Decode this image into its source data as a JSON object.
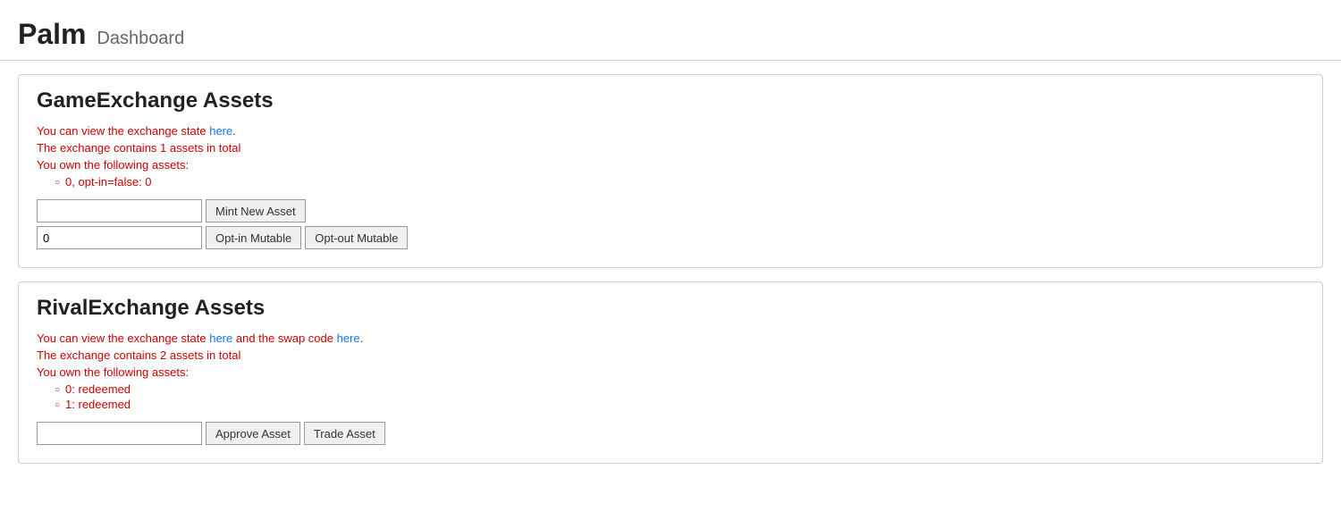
{
  "header": {
    "title": "Palm",
    "subtitle": "Dashboard"
  },
  "game_exchange": {
    "title": "GameExchange Assets",
    "info_line1_prefix": "You can view the exchange state ",
    "info_line1_link": "here",
    "info_line1_suffix": ".",
    "info_line2": "The exchange contains 1 assets in total",
    "info_line3": "You own the following assets:",
    "assets": [
      "0, opt-in=false: 0"
    ],
    "mint_input_placeholder": "",
    "mint_input_value": "",
    "mint_button_label": "Mint New Asset",
    "optin_input_value": "0",
    "optin_button_label": "Opt-in Mutable",
    "optout_button_label": "Opt-out Mutable"
  },
  "rival_exchange": {
    "title": "RivalExchange Assets",
    "info_line1_prefix": "You can view the exchange state ",
    "info_line1_link1": "here",
    "info_line1_middle": " and the swap code ",
    "info_line1_link2": "here",
    "info_line1_suffix": ".",
    "info_line2": "The exchange contains 2 assets in total",
    "info_line3": "You own the following assets:",
    "assets": [
      "0: redeemed",
      "1: redeemed"
    ],
    "approve_input_placeholder": "",
    "approve_input_value": "",
    "approve_button_label": "Approve Asset",
    "trade_button_label": "Trade Asset"
  },
  "colors": {
    "info_text": "#cc0000",
    "link": "#1a73e8",
    "border": "#cccccc"
  }
}
